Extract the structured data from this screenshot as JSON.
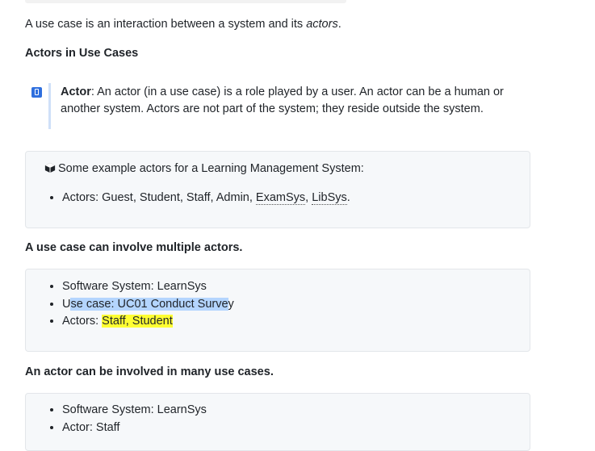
{
  "intro": {
    "text_a": "A use case is an interaction between a system and its ",
    "text_em": "actors",
    "text_b": "."
  },
  "section1": {
    "heading": "Actors in Use Cases"
  },
  "definition": {
    "term": "Actor",
    "text": ": An actor (in a use case) is a role played by a user. An actor can be a human or another system. Actors are not part of the system; they reside outside the system.",
    "icon": "book-icon"
  },
  "example_box": {
    "icon": "package-icon",
    "intro": "Some example actors for a Learning Management System:",
    "item_prefix": "Actors: Guest, Student, Staff, Admin, ",
    "item_link1": "ExamSys",
    "item_sep": ", ",
    "item_link2": "LibSys",
    "item_end": "."
  },
  "section2": {
    "heading": "A use case can involve multiple actors."
  },
  "box2": {
    "item1": "Software System: LearnSys",
    "item2_pre": "U",
    "item2_sel": "se case: UC01 Conduct Surve",
    "item2_post": "y",
    "item3_pre": "Actors: ",
    "item3_hl": " Staff, Student "
  },
  "section3": {
    "heading": "An actor can be involved in many use cases."
  },
  "box3": {
    "item1": "Software System: LearnSys",
    "item2": "Actor: Staff"
  }
}
